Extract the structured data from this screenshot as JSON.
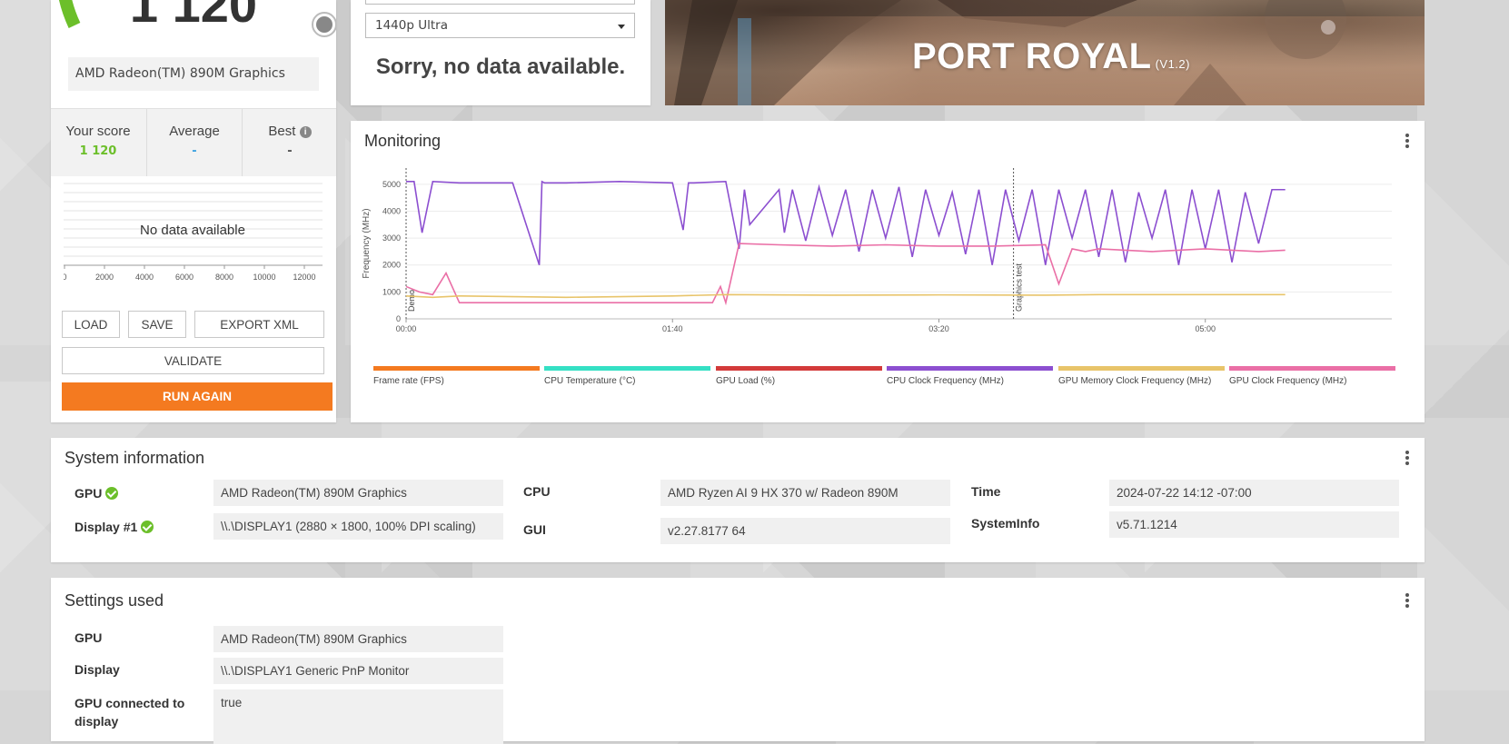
{
  "score_card": {
    "score": "1 120",
    "gpu_name": "AMD Radeon(TM) 890M Graphics",
    "your_score_label": "Your score",
    "your_score_value": "1 120",
    "average_label": "Average",
    "average_value": "-",
    "best_label": "Best",
    "best_value": "-",
    "no_data": "No data available",
    "axis_ticks": [
      "0",
      "2000",
      "4000",
      "6000",
      "8000",
      "10000",
      "12000"
    ],
    "buttons": {
      "load": "LOAD",
      "save": "SAVE",
      "export_xml": "EXPORT XML",
      "validate": "VALIDATE",
      "run_again": "RUN AGAIN"
    },
    "colors": {
      "gauge": "#6cbf2a",
      "score_green": "#6cbf2a",
      "average_blue": "#3ea3e0",
      "run_again": "#f47a20"
    }
  },
  "preset": {
    "selected": "1440p Ultra",
    "message": "Sorry, no data available."
  },
  "hero": {
    "title": "PORT ROYAL",
    "version": "(V1.2)"
  },
  "monitoring": {
    "title": "Monitoring",
    "ylabel": "Frequency (MHz)",
    "yticks": [
      "0",
      "1000",
      "2000",
      "3000",
      "4000",
      "5000"
    ],
    "xticks": [
      "00:00",
      "01:40",
      "03:20",
      "05:00"
    ],
    "markers": [
      "Demo",
      "Graphics test"
    ],
    "legend": [
      {
        "label": "Frame rate (FPS)",
        "color": "#f47a20"
      },
      {
        "label": "CPU Temperature (°C)",
        "color": "#35e0c4"
      },
      {
        "label": "GPU Load (%)",
        "color": "#d33a3a"
      },
      {
        "label": "CPU Clock Frequency (MHz)",
        "color": "#8c4fd0"
      },
      {
        "label": "GPU Memory Clock Frequency (MHz)",
        "color": "#e8c46a"
      },
      {
        "label": "GPU Clock Frequency (MHz)",
        "color": "#ea6fa6"
      }
    ]
  },
  "chart_data": {
    "type": "line",
    "xlabel": "",
    "ylabel": "Frequency (MHz)",
    "ylim": [
      0,
      5500
    ],
    "x_unit": "seconds",
    "series": [
      {
        "name": "CPU Clock Frequency (MHz)",
        "x": [
          0,
          3,
          6,
          10,
          20,
          40,
          50,
          51,
          52,
          60,
          80,
          100,
          104,
          106,
          108,
          120,
          125,
          127,
          129,
          140,
          142,
          145,
          150,
          155,
          160,
          165,
          170,
          175,
          180,
          185,
          190,
          195,
          200,
          205,
          210,
          215,
          220,
          225,
          230,
          235,
          240,
          245,
          250,
          255,
          260,
          265,
          270,
          275,
          280,
          285,
          290,
          295,
          300,
          305,
          310,
          315,
          320,
          325,
          330
        ],
        "values": [
          5100,
          5100,
          3200,
          5100,
          5050,
          5050,
          2000,
          5100,
          5050,
          5050,
          5100,
          5050,
          3300,
          5050,
          5050,
          5100,
          2600,
          4800,
          3500,
          4800,
          3200,
          4800,
          2900,
          4900,
          3100,
          4800,
          2500,
          4800,
          3000,
          4900,
          2300,
          4800,
          3100,
          4700,
          2400,
          4800,
          2000,
          4800,
          2900,
          4800,
          2000,
          4800,
          3000,
          4800,
          2300,
          4800,
          2100,
          4700,
          3000,
          4800,
          2000,
          4800,
          2600,
          4800,
          2100,
          4700,
          2800,
          4800,
          4800
        ]
      },
      {
        "name": "GPU Clock Frequency (MHz)",
        "x": [
          0,
          5,
          10,
          15,
          20,
          25,
          30,
          60,
          100,
          115,
          118,
          120,
          125,
          140,
          160,
          180,
          200,
          220,
          240,
          245,
          250,
          255,
          260,
          280,
          300,
          320,
          330
        ],
        "values": [
          1200,
          1000,
          900,
          1700,
          600,
          600,
          600,
          600,
          600,
          600,
          1200,
          600,
          2800,
          2750,
          2700,
          2750,
          2700,
          2700,
          2750,
          1300,
          2600,
          2500,
          2600,
          2500,
          2600,
          2500,
          2550
        ]
      },
      {
        "name": "GPU Memory Clock Frequency (MHz)",
        "x": [
          0,
          10,
          20,
          60,
          100,
          120,
          160,
          200,
          240,
          260,
          300,
          330
        ],
        "values": [
          850,
          800,
          850,
          800,
          850,
          900,
          880,
          890,
          880,
          900,
          900,
          900
        ]
      }
    ]
  },
  "system_info": {
    "title": "System information",
    "gpu_label": "GPU",
    "gpu_value": "AMD Radeon(TM) 890M Graphics",
    "display_label": "Display #1",
    "display_value": "\\\\.\\DISPLAY1 (2880 × 1800, 100% DPI scaling)",
    "cpu_label": "CPU",
    "cpu_value": "AMD Ryzen AI 9 HX 370 w/ Radeon 890M",
    "gui_label": "GUI",
    "gui_value": "v2.27.8177 64",
    "time_label": "Time",
    "time_value": "2024-07-22 14:12 -07:00",
    "sysinfo_label": "SystemInfo",
    "sysinfo_value": "v5.71.1214"
  },
  "settings": {
    "title": "Settings used",
    "gpu_label": "GPU",
    "gpu_value": "AMD Radeon(TM) 890M Graphics",
    "display_label": "Display",
    "display_value": "\\\\.\\DISPLAY1 Generic PnP Monitor",
    "gpu_connected_label_line1": "GPU connected to",
    "gpu_connected_label_line2": "display",
    "gpu_connected_value": "true"
  }
}
